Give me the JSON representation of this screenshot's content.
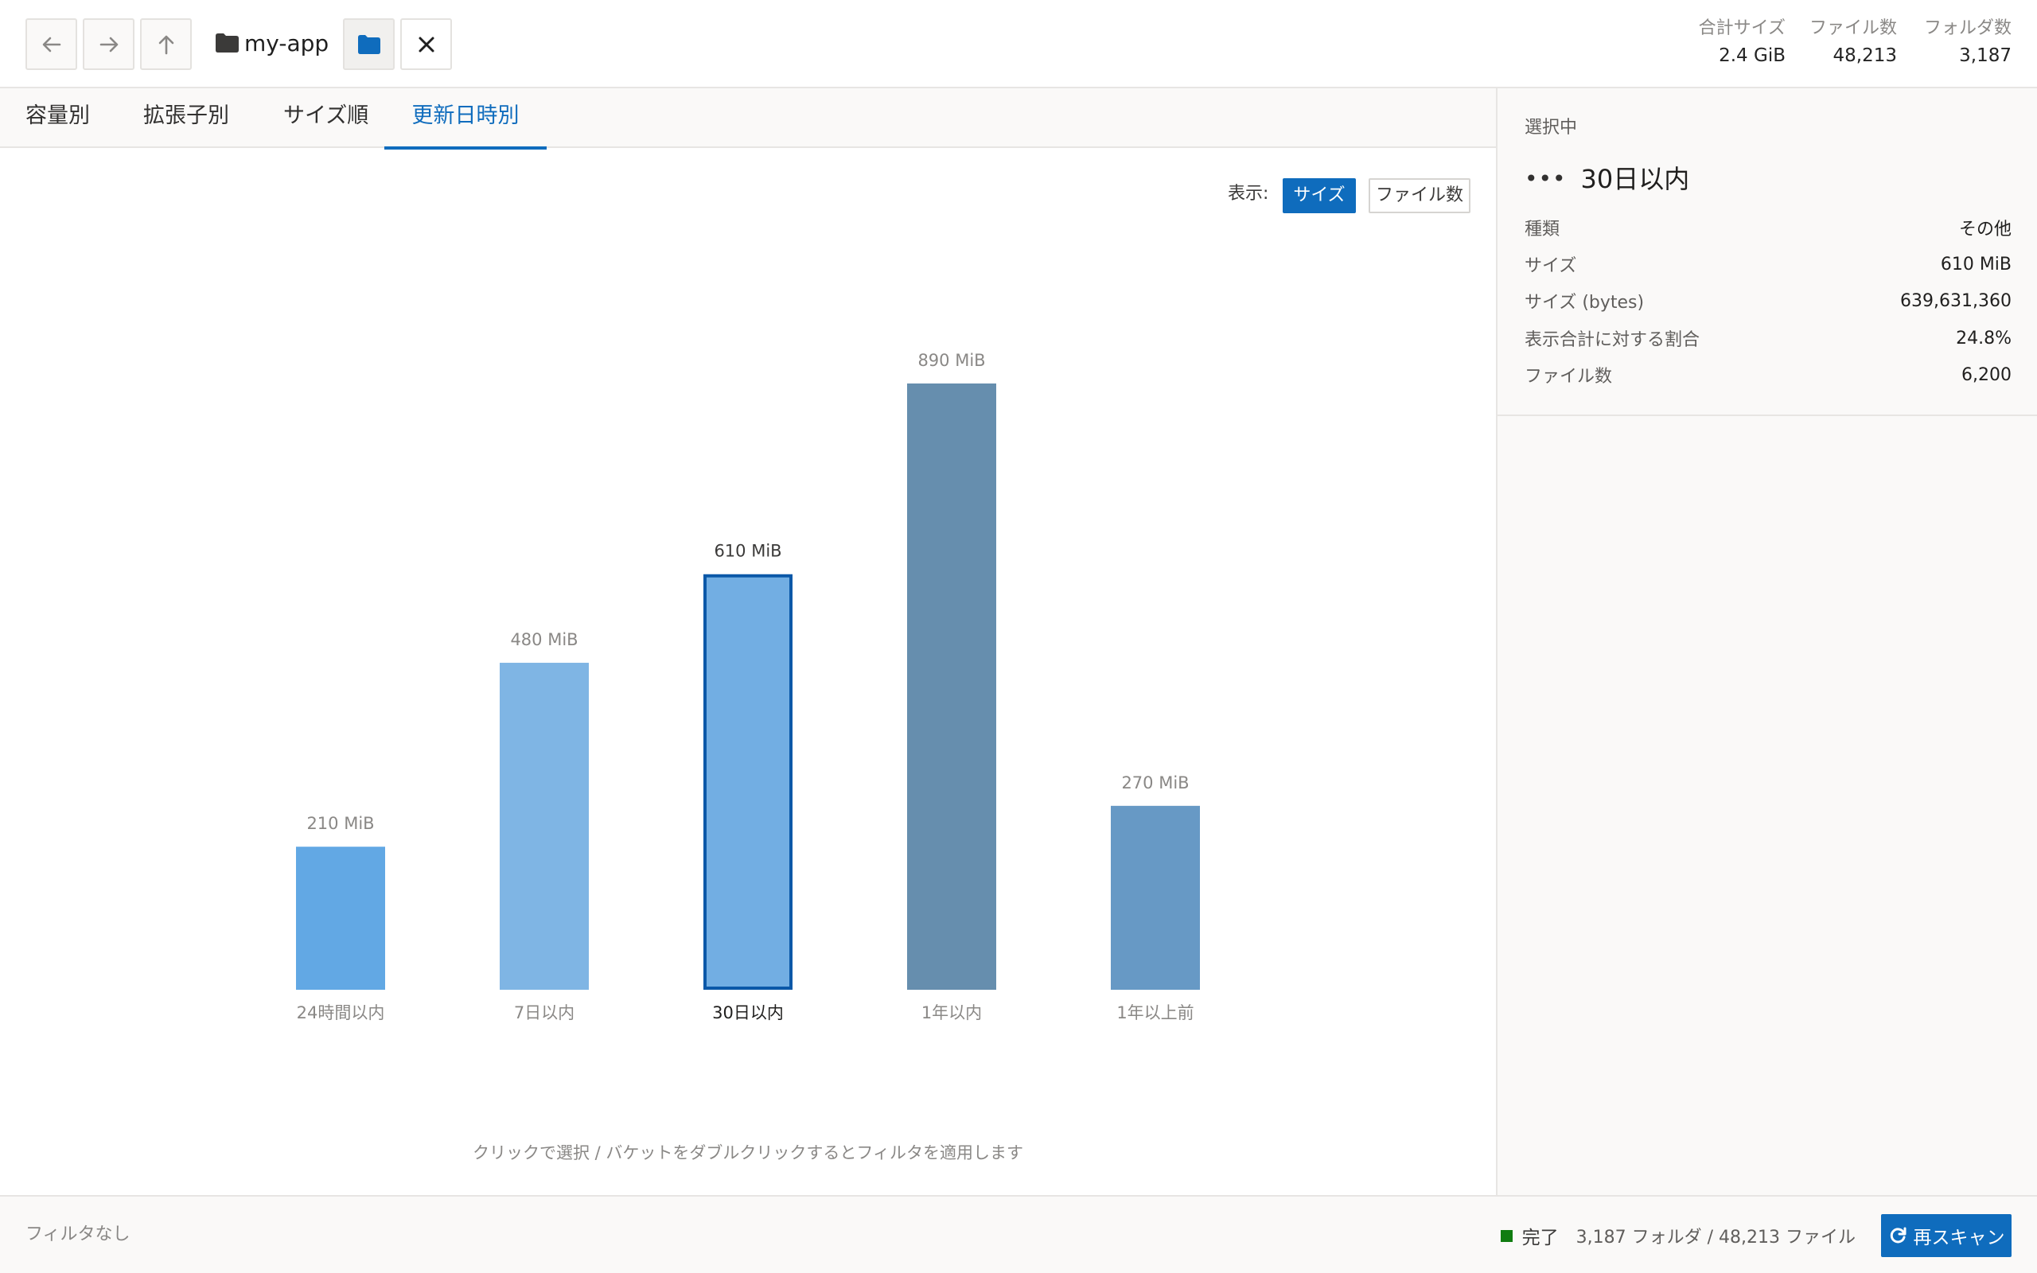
{
  "toolbar": {
    "path": "my-app",
    "stats": [
      {
        "label": "合計サイズ",
        "value": "2.4 GiB"
      },
      {
        "label": "ファイル数",
        "value": "48,213"
      },
      {
        "label": "フォルダ数",
        "value": "3,187"
      }
    ]
  },
  "tabs": [
    {
      "label": "容量別",
      "active": false
    },
    {
      "label": "拡張子別",
      "active": false
    },
    {
      "label": "サイズ順",
      "active": false
    },
    {
      "label": "更新日時別",
      "active": true
    }
  ],
  "display_mode": {
    "label": "表示:",
    "options": [
      "サイズ",
      "ファイル数"
    ],
    "selected": "サイズ"
  },
  "chart_data": {
    "type": "bar",
    "categories": [
      "24時間以内",
      "7日以内",
      "30日以内",
      "1年以内",
      "1年以上前"
    ],
    "values": [
      210,
      480,
      610,
      890,
      270
    ],
    "value_labels": [
      "210 MiB",
      "480 MiB",
      "610 MiB",
      "890 MiB",
      "270 MiB"
    ],
    "unit": "MiB",
    "ylim": [
      0,
      890
    ],
    "selected_index": 2,
    "colors": [
      "#62a8e4",
      "#7fb5e4",
      "#72aee3",
      "#668eae",
      "#6799c5"
    ],
    "selected_border": "#0b58a8",
    "grid": false
  },
  "chart_hint": "クリックで選択 / バケットをダブルクリックするとフィルタを適用します",
  "selection": {
    "heading": "選択中",
    "icon": "•••",
    "name": "30日以内",
    "rows": [
      {
        "key": "種類",
        "value": "その他"
      },
      {
        "key": "サイズ",
        "value": "610 MiB"
      },
      {
        "key": "サイズ (bytes)",
        "value": "639,631,360"
      },
      {
        "key": "表示合計に対する割合",
        "value": "24.8%"
      },
      {
        "key": "ファイル数",
        "value": "6,200"
      }
    ]
  },
  "statusbar": {
    "filter": "フィルタなし",
    "state": "完了",
    "counts": "3,187 フォルダ / 48,213 ファイル",
    "rescan_label": "再スキャン"
  },
  "colors": {
    "accent": "#0f6cbd",
    "status_ok": "#107c10"
  }
}
